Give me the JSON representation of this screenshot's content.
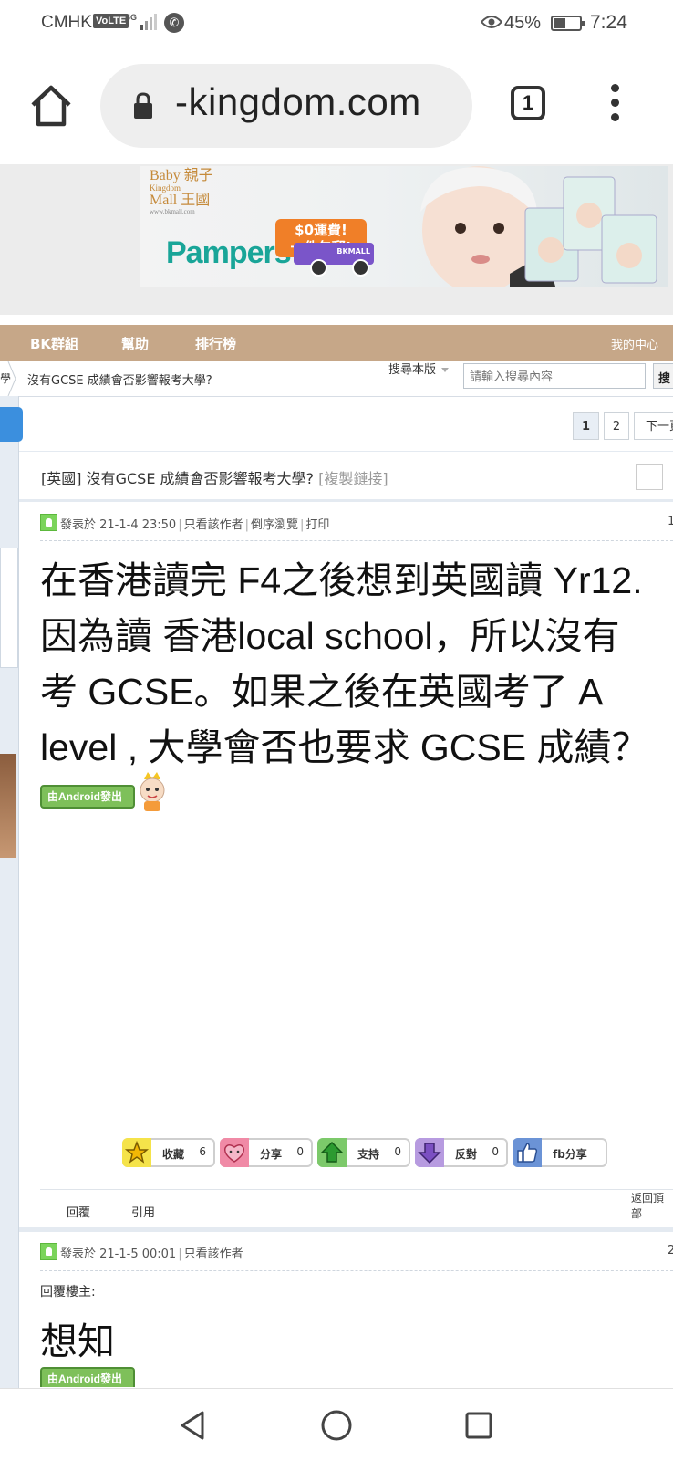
{
  "status_bar": {
    "carrier": "CMHK",
    "volte": "VoLTE",
    "network": "4G",
    "battery": "45%",
    "time": "7:24"
  },
  "browser": {
    "url": "-kingdom.com",
    "tab_count": "1"
  },
  "ad": {
    "brand_line1": "Baby 親子",
    "brand_line2": "Kingdom",
    "brand_line3": "Mall 王國",
    "brand_url": "www.bkmall.com",
    "product": "Pampers",
    "promo_line1": "$0運費!",
    "promo_line2": "一件包郵!",
    "truck_label": "BKMALL"
  },
  "nav": {
    "items": [
      "BK群組",
      "幫助",
      "排行榜"
    ],
    "right": "我的中心"
  },
  "breadcrumb": {
    "prev": "學",
    "current": "沒有GCSE 成績會否影響報考大學?",
    "search_scope": "搜尋本版",
    "search_placeholder": "請輸入搜尋內容",
    "search_button": "搜"
  },
  "pagination": {
    "pages": [
      "1",
      "2"
    ],
    "next": "下一頁"
  },
  "topic": {
    "category": "[英國]",
    "title": "沒有GCSE 成績會否影響報考大學?",
    "copy_link": "[複製鏈接]"
  },
  "post1": {
    "posted": "發表於 21-1-4 23:50",
    "only_author": "只看該作者",
    "reverse": "倒序瀏覽",
    "print": "打印",
    "floor": "1",
    "body_lines": [
      "在香港讀完 F4之後想到英國讀 Yr12.",
      "因為讀 香港local school，所以沒有",
      "考 GCSE。如果之後在英國考了 A",
      "level , 大學會否也要求  GCSE 成績？"
    ],
    "badge": "由Android發出"
  },
  "reactions": [
    {
      "label": "收藏",
      "count": "6",
      "icon": "star-icon",
      "color": "#f5e34a"
    },
    {
      "label": "分享",
      "count": "0",
      "icon": "heart-face-icon",
      "color": "#f08aa6"
    },
    {
      "label": "支持",
      "count": "0",
      "icon": "up-arrow-icon",
      "color": "#7cc96a"
    },
    {
      "label": "反對",
      "count": "0",
      "icon": "down-arrow-icon",
      "color": "#b79be0"
    },
    {
      "label": "fb分享",
      "count": "",
      "icon": "thumbs-up-icon",
      "color": "#6b93d6"
    }
  ],
  "post_actions": {
    "reply": "回覆",
    "quote": "引用",
    "back_top": "返回頂部"
  },
  "post2": {
    "posted": "發表於 21-1-5 00:01",
    "only_author": "只看該作者",
    "floor": "2",
    "reply_to": "回覆樓主:",
    "body": "想知",
    "badge": "由Android發出"
  }
}
